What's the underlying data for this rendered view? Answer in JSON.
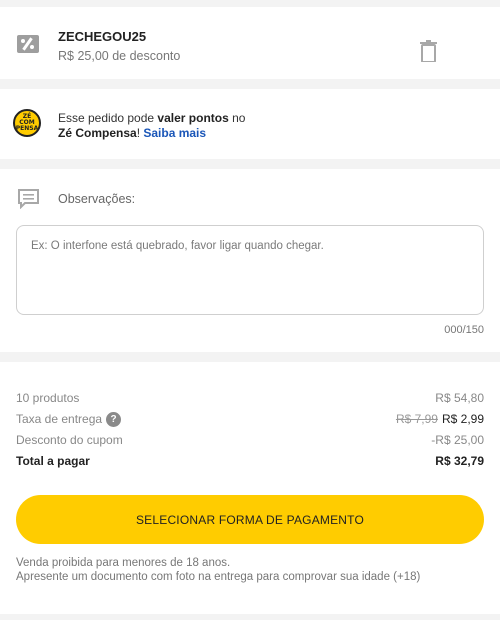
{
  "coupon": {
    "code": "ZECHEGOU25",
    "description": "R$ 25,00 de desconto",
    "icon": "coupon-icon",
    "delete_icon": "trash-icon"
  },
  "points": {
    "logo_lines": [
      "ZÉ",
      "COM",
      "PENSA"
    ],
    "text_part1": "Esse pedido pode ",
    "text_bold": "valer pontos",
    "text_part2": " no",
    "brand": "Zé Compensa",
    "text_part3": "! ",
    "link": "Saiba mais"
  },
  "observations": {
    "label": "Observações:",
    "placeholder": "Ex: O interfone está quebrado, favor ligar quando chegar.",
    "value": "",
    "counter": "000/150",
    "icon": "comment-icon"
  },
  "summary": {
    "products_label": "10 produtos",
    "products_value": "R$ 54,80",
    "delivery_label": "Taxa de entrega",
    "delivery_old": "R$ 7,99",
    "delivery_new": "R$ 2,99",
    "help_icon": "?",
    "coupon_label": "Desconto do cupom",
    "coupon_value": "-R$ 25,00",
    "total_label": "Total a pagar",
    "total_value": "R$ 32,79"
  },
  "payment_button": "SELECIONAR FORMA DE PAGAMENTO",
  "disclaimer": {
    "line1": "Venda proibida para menores de 18 anos.",
    "line2": "Apresente um documento com foto na entrega para comprovar sua idade (+18)"
  },
  "colors": {
    "accent": "#ffcc00",
    "link": "#1a56b8",
    "background": "#f3f3f3"
  }
}
